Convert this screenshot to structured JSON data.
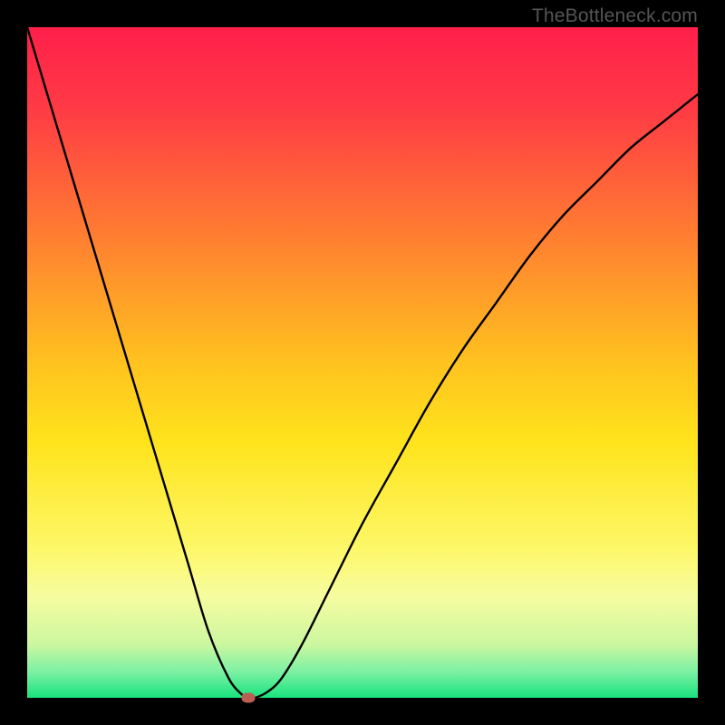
{
  "watermark": {
    "text": "TheBottleneck.com"
  },
  "chart_data": {
    "type": "line",
    "title": "",
    "xlabel": "",
    "ylabel": "",
    "xlim": [
      0,
      100
    ],
    "ylim": [
      0,
      100
    ],
    "grid": false,
    "legend": false,
    "background": {
      "type": "vertical_gradient",
      "stops": [
        {
          "pct": 0,
          "color": "#ff1f4a"
        },
        {
          "pct": 12,
          "color": "#ff3a45"
        },
        {
          "pct": 30,
          "color": "#ff7a32"
        },
        {
          "pct": 50,
          "color": "#ffc21f"
        },
        {
          "pct": 62,
          "color": "#ffe41c"
        },
        {
          "pct": 78,
          "color": "#fdf86a"
        },
        {
          "pct": 85,
          "color": "#f6fca0"
        },
        {
          "pct": 92,
          "color": "#ccf7a0"
        },
        {
          "pct": 96,
          "color": "#7ff1a4"
        },
        {
          "pct": 100,
          "color": "#18e37e"
        }
      ]
    },
    "series": [
      {
        "name": "bottleneck-curve",
        "color": "#000000",
        "x": [
          0,
          3,
          6,
          9,
          12,
          15,
          18,
          21,
          24,
          27,
          30,
          32,
          33,
          34,
          36,
          38,
          41,
          45,
          50,
          55,
          60,
          65,
          70,
          75,
          80,
          85,
          90,
          95,
          100
        ],
        "y": [
          100,
          90,
          80,
          70,
          60,
          50,
          40,
          30,
          20,
          10,
          3,
          0.5,
          0,
          0,
          1,
          3,
          8,
          16,
          26,
          35,
          44,
          52,
          59,
          66,
          72,
          77,
          82,
          86,
          90
        ]
      }
    ],
    "marker": {
      "x": 33,
      "y": 0,
      "color": "#bb5e53"
    }
  }
}
